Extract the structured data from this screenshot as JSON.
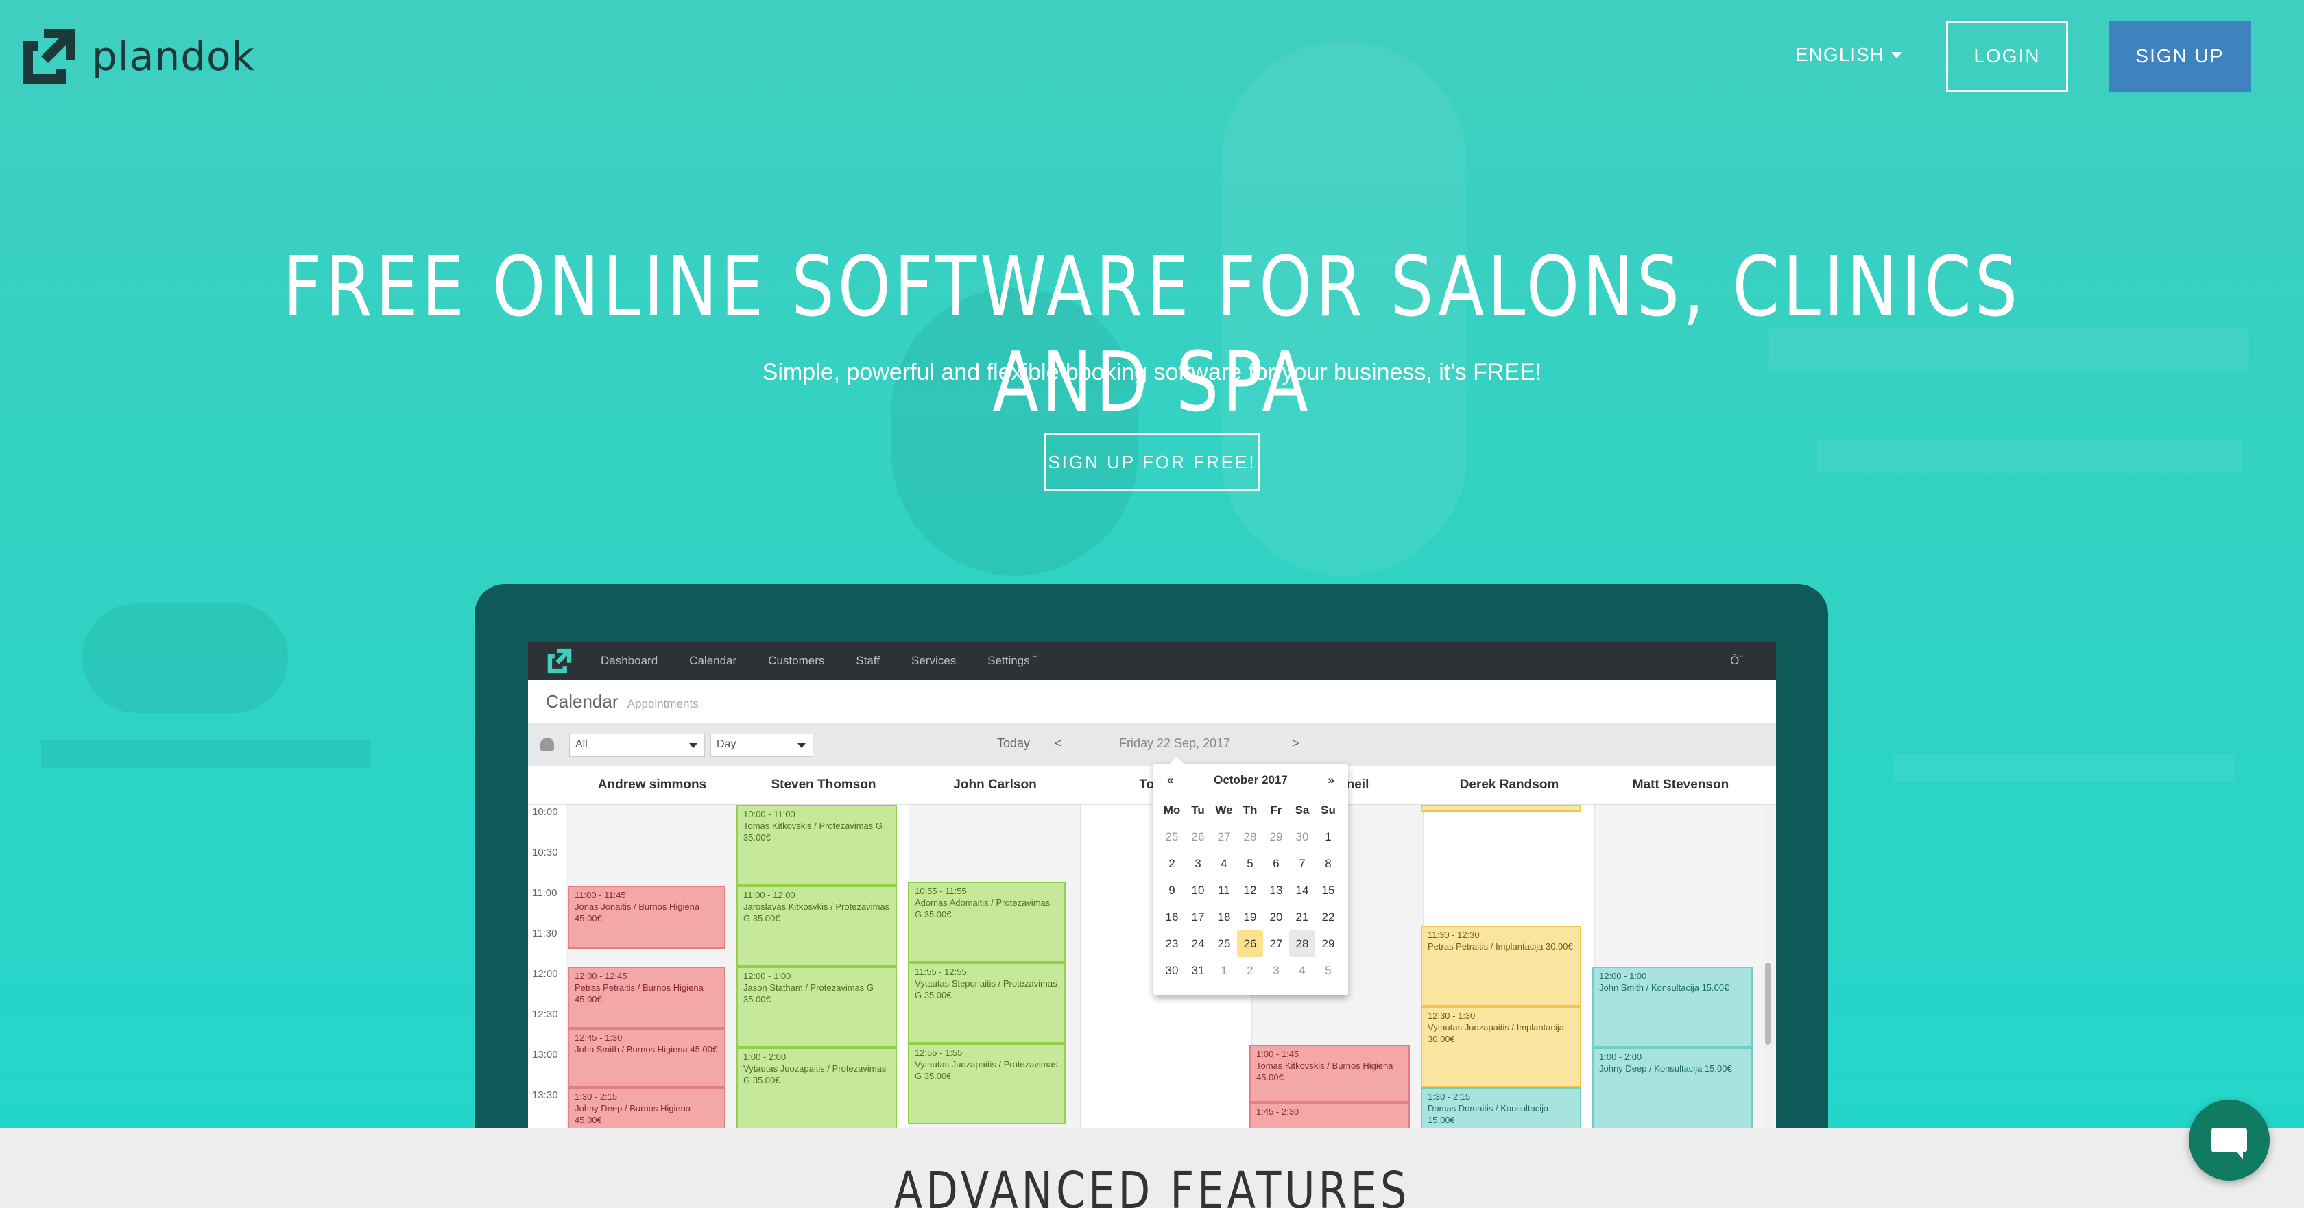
{
  "header": {
    "logo_text": "plandok",
    "language": "ENGLISH",
    "login": "LOGIN",
    "signup": "SIGN UP"
  },
  "hero": {
    "headline": "FREE ONLINE SOFTWARE FOR SALONS, CLINICS AND SPA",
    "subline": "Simple, powerful and flexible booking software for your business, it's FREE!",
    "cta": "SIGN UP FOR FREE!"
  },
  "app": {
    "nav": [
      "Dashboard",
      "Calendar",
      "Customers",
      "Staff",
      "Services",
      "Settings ˇ"
    ],
    "user": "Ôˇ",
    "title": "Calendar",
    "subtitle": "Appointments",
    "filter_staff": "All",
    "filter_view": "Day",
    "today": "Today",
    "prev": "<",
    "date": "Friday 22 Sep, 2017",
    "next": ">",
    "columns": [
      "Andrew simmons",
      "Steven Thomson",
      "John Carlson",
      "Tor",
      "neil",
      "Derek Randsom",
      "Matt Stevenson"
    ],
    "times": [
      "10:00",
      "10:30",
      "11:00",
      "11:30",
      "12:00",
      "12:30",
      "13:00",
      "13:30"
    ],
    "appointments": [
      {
        "time": "11:00 - 11:45",
        "text": "Jonas Jonaitis / Burnos Higiena 45.00€"
      },
      {
        "time": "12:00 - 12:45",
        "text": "Petras Petraitis / Burnos Higiena 45.00€"
      },
      {
        "time": "12:45 - 1:30",
        "text": "John Smith / Burnos Higiena 45.00€"
      },
      {
        "time": "1:30 - 2:15",
        "text": "Johny Deep / Burnos Higiena 45.00€"
      },
      {
        "time": "10:00 - 11:00",
        "text": "Tomas Kitkovskis / Protezavimas G 35.00€"
      },
      {
        "time": "11:00 - 12:00",
        "text": "Jaroslavas Kitkosvkis / Protezavimas G 35.00€"
      },
      {
        "time": "12:00 - 1:00",
        "text": "Jason Statham / Protezavimas G 35.00€"
      },
      {
        "time": "1:00 - 2:00",
        "text": "Vytautas Juozapaitis / Protezavimas G 35.00€"
      },
      {
        "time": "10:55 - 11:55",
        "text": "Adomas Adomaitis / Protezavimas G 35.00€"
      },
      {
        "time": "11:55 - 12:55",
        "text": "Vytautas Steponaitis / Protezavimas G 35.00€"
      },
      {
        "time": "12:55 - 1:55",
        "text": "Vytautas Juozapaitis / Protezavimas G 35.00€"
      },
      {
        "time": "1:00 - 1:45",
        "text": "Tomas Kitkovskis / Burnos Higiena 45.00€"
      },
      {
        "time": "1:45 - 2:30",
        "text": ""
      },
      {
        "time": "11:30 - 12:30",
        "text": "Petras Petraitis / Implantacija 30.00€"
      },
      {
        "time": "12:30 - 1:30",
        "text": "Vytautas Juozapaitis / Implantacija 30.00€"
      },
      {
        "time": "1:30 - 2:15",
        "text": "Domas Domaitis / Konsultacija 15.00€"
      },
      {
        "time": "12:00 - 1:00",
        "text": "John Smith / Konsultacija 15.00€"
      },
      {
        "time": "1:00 - 2:00",
        "text": "Johny Deep / Konsultacija 15.00€"
      }
    ],
    "picker": {
      "prev": "«",
      "month": "October 2017",
      "next": "»",
      "days_of_week": [
        "Mo",
        "Tu",
        "We",
        "Th",
        "Fr",
        "Sa",
        "Su"
      ],
      "weeks": [
        [
          "25",
          "26",
          "27",
          "28",
          "29",
          "30",
          "1"
        ],
        [
          "2",
          "3",
          "4",
          "5",
          "6",
          "7",
          "8"
        ],
        [
          "9",
          "10",
          "11",
          "12",
          "13",
          "14",
          "15"
        ],
        [
          "16",
          "17",
          "18",
          "19",
          "20",
          "21",
          "22"
        ],
        [
          "23",
          "24",
          "25",
          "26",
          "27",
          "28",
          "29"
        ],
        [
          "30",
          "31",
          "1",
          "2",
          "3",
          "4",
          "5"
        ]
      ]
    }
  },
  "features": {
    "title": "ADVANCED FEATURES"
  },
  "colors": {
    "hero": "#32d2c3",
    "signup_button": "#3f82c0",
    "laptop": "#0f5a58",
    "chat_button": "#117a62"
  }
}
